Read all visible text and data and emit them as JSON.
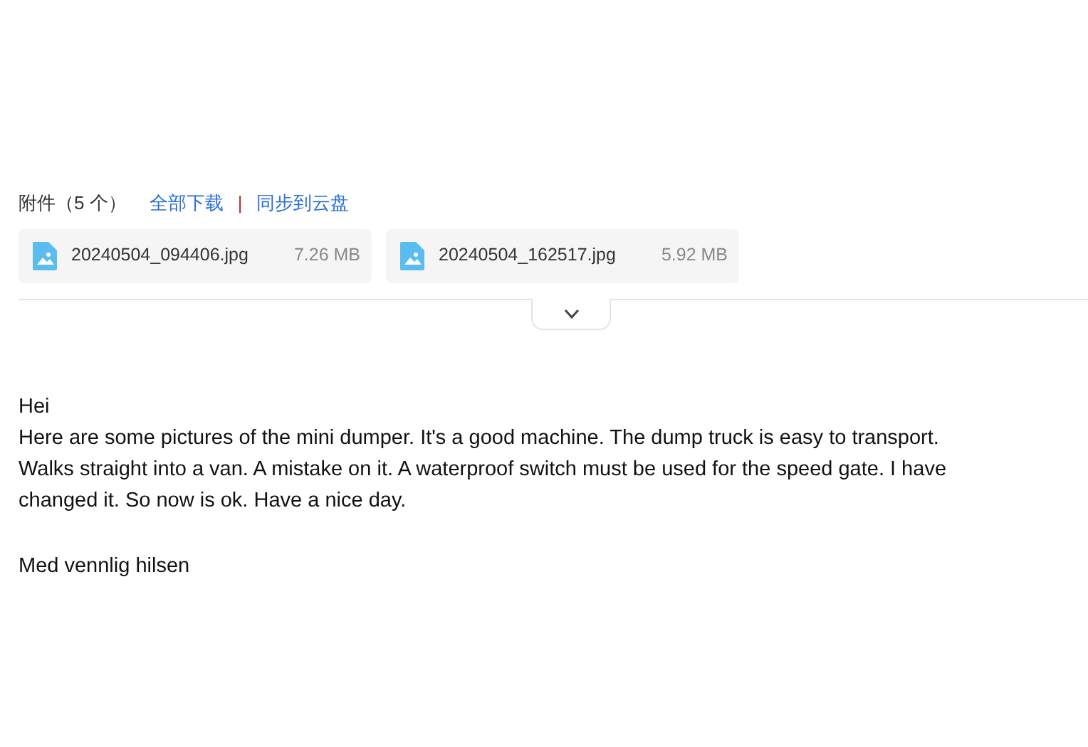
{
  "attachments": {
    "label": "附件（5 个）",
    "actions": [
      {
        "label": "全部下载"
      },
      {
        "label": "同步到云盘"
      }
    ],
    "separator": "|",
    "files": [
      {
        "name": "20240504_094406.jpg",
        "size": "7.26 MB"
      },
      {
        "name": "20240504_162517.jpg",
        "size": "5.92 MB"
      }
    ],
    "expanded": false
  },
  "message": {
    "greeting": "Hei",
    "body_lines": [
      "Here are some pictures of the mini dumper. It's a good machine. The dump truck is easy to transport.",
      "Walks straight into a van. A mistake on it. A waterproof switch must be used for the speed gate. I have",
      "changed it. So now is ok. Have a nice day."
    ],
    "signoff": "Med vennlig hilsen"
  }
}
